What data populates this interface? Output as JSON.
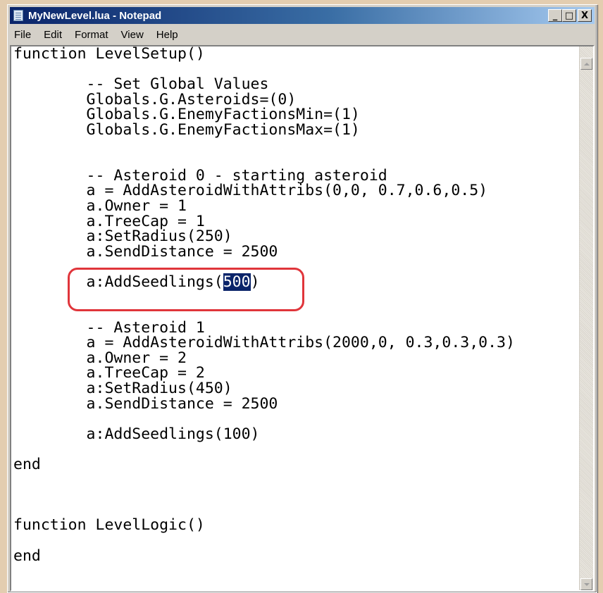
{
  "window": {
    "title": "MyNewLevel.lua - Notepad",
    "buttons": {
      "minimize": "_",
      "maximize": "□",
      "close": "X"
    }
  },
  "menu": [
    "File",
    "Edit",
    "Format",
    "View",
    "Help"
  ],
  "editor": {
    "lines": [
      "function LevelSetup()",
      "",
      "        -- Set Global Values",
      "        Globals.G.Asteroids=(0)",
      "        Globals.G.EnemyFactionsMin=(1)",
      "        Globals.G.EnemyFactionsMax=(1)",
      "",
      "",
      "        -- Asteroid 0 - starting asteroid",
      "        a = AddAsteroidWithAttribs(0,0, 0.7,0.6,0.5)",
      "        a.Owner = 1",
      "        a.TreeCap = 1",
      "        a:SetRadius(250)",
      "        a.SendDistance = 2500",
      "",
      "        a:AddSeedlings(500)",
      "",
      "",
      "        -- Asteroid 1",
      "        a = AddAsteroidWithAttribs(2000,0, 0.3,0.3,0.3)",
      "        a.Owner = 2",
      "        a.TreeCap = 2",
      "        a:SetRadius(450)",
      "        a.SendDistance = 2500",
      "",
      "        a:AddSeedlings(100)",
      "",
      "end",
      "",
      "",
      "",
      "function LevelLogic()",
      "",
      "end"
    ],
    "selection": {
      "line": 15,
      "before": "        a:AddSeedlings(",
      "selected": "500",
      "after": ")"
    }
  },
  "colors": {
    "callout": "#e0353b",
    "selection": "#0a246a"
  }
}
